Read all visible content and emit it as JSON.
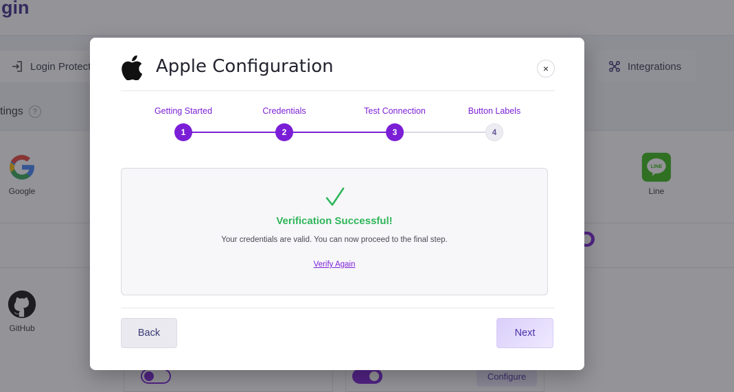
{
  "background": {
    "brand": "gin",
    "tabs": [
      {
        "label": "Login Protect",
        "icon": "login-icon"
      },
      {
        "label": "Integrations",
        "icon": "integrations-icon"
      }
    ],
    "settings_label": "tings",
    "help_glyph": "?",
    "providers": [
      {
        "name": "Google",
        "icon": "google-icon"
      },
      {
        "name": "Line",
        "icon": "line-icon"
      },
      {
        "name": "GitHub",
        "icon": "github-icon"
      }
    ],
    "line_logo_text": "LINE",
    "configure_label": "Configure"
  },
  "modal": {
    "title": "Apple Configuration",
    "close_glyph": "×",
    "steps": [
      {
        "number": "1",
        "label": "Getting Started",
        "status": "done"
      },
      {
        "number": "2",
        "label": "Credentials",
        "status": "done"
      },
      {
        "number": "3",
        "label": "Test Connection",
        "status": "done"
      },
      {
        "number": "4",
        "label": "Button Labels",
        "status": "todo"
      }
    ],
    "result": {
      "title": "Verification Successful!",
      "message": "Your credentials are valid. You can now proceed to the final step.",
      "verify_again_label": "Verify Again"
    },
    "buttons": {
      "back_label": "Back",
      "next_label": "Next"
    }
  },
  "colors": {
    "accent": "#7b1fd6",
    "success": "#2fb55a",
    "overlay": "rgba(40,40,50,0.5)"
  }
}
